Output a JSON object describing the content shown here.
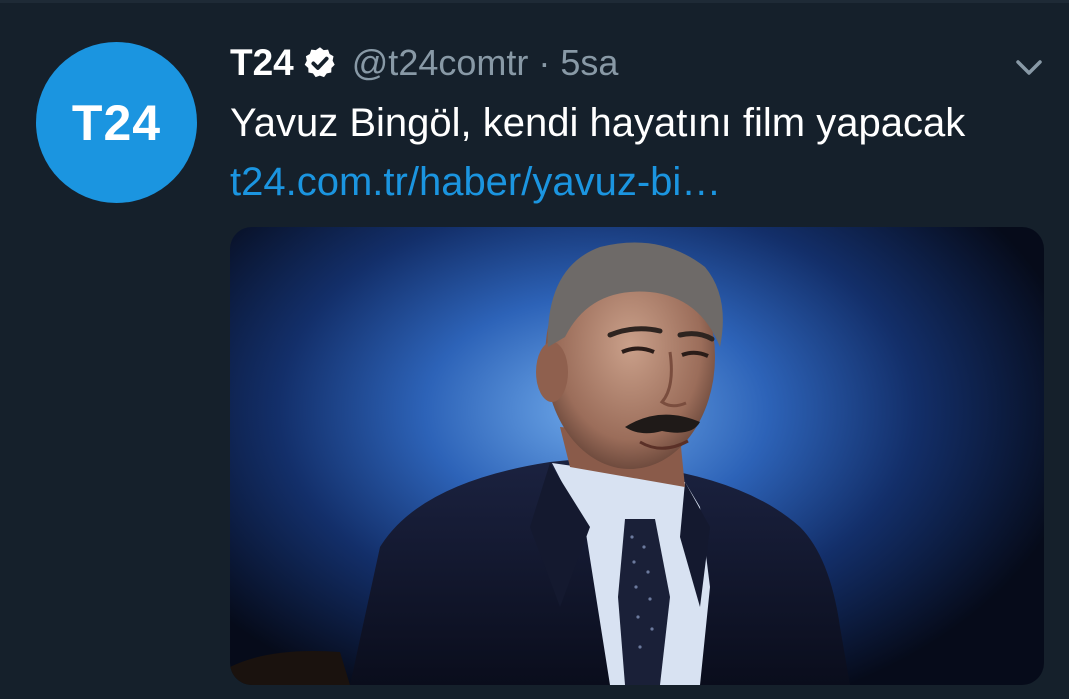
{
  "tweet": {
    "avatar_text": "T24",
    "display_name": "T24",
    "handle": "@t24comtr",
    "separator": "·",
    "time": "5sa",
    "text": "Yavuz Bingöl, kendi hayatını film yapacak",
    "link_text": "t24.com.tr/haber/yavuz-bi…",
    "icons": {
      "verified": "verified-badge-icon",
      "menu": "chevron-down-icon"
    }
  },
  "colors": {
    "background": "#15202b",
    "accent": "#1b95e0",
    "secondary_text": "#8899a6",
    "primary_text": "#ffffff"
  }
}
